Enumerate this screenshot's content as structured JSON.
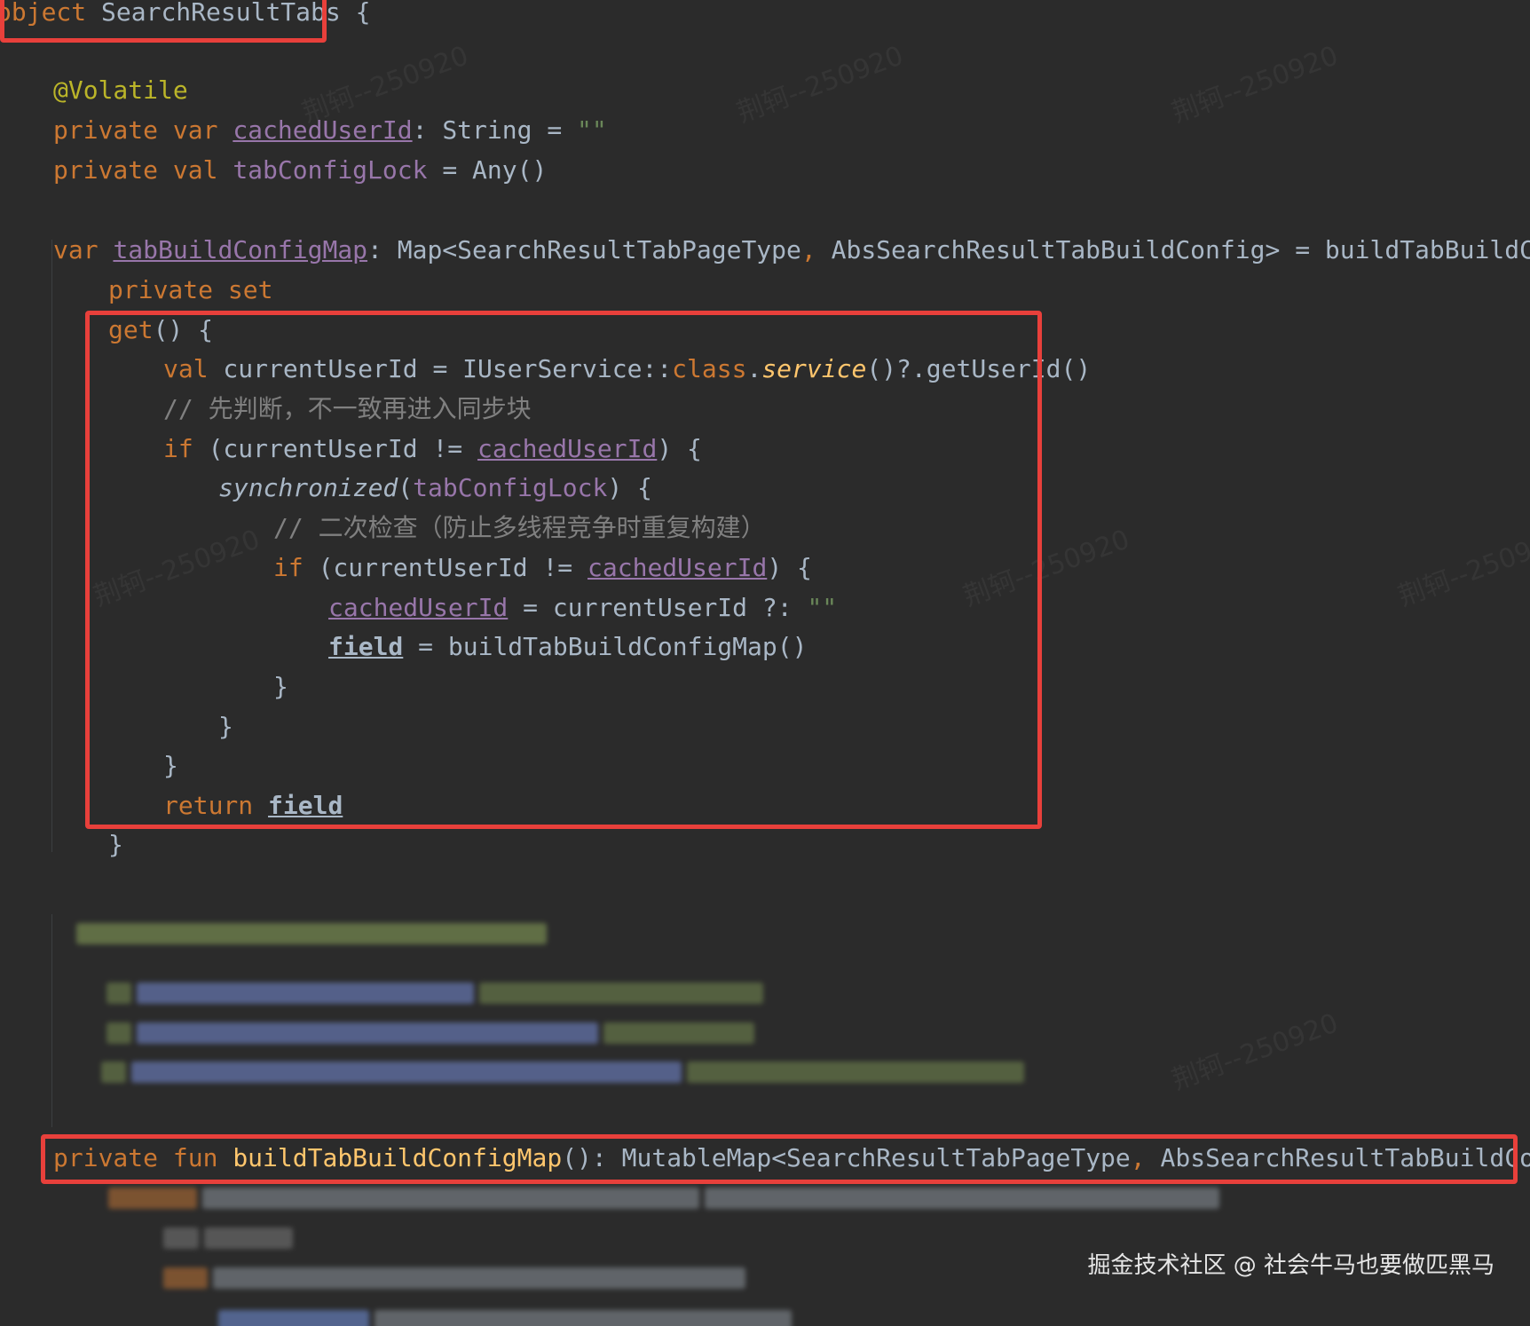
{
  "code": {
    "line_object": {
      "kw": "object",
      "name": "SearchResultTabs",
      "brace": " {"
    },
    "line_annotation": "@Volatile",
    "line_cached": {
      "kw1": "private",
      "kw2": "var",
      "prop": "cachedUserId",
      "rest": ": String = ",
      "str": "\"\""
    },
    "line_lock": {
      "kw1": "private",
      "kw2": "val",
      "prop": "tabConfigLock",
      "rest": " = Any()"
    },
    "line_map": {
      "kw": "var",
      "prop": "tabBuildConfigMap",
      "rest1": ": Map<SearchResultTabPageType",
      "comma": ",",
      "rest2": " AbsSearchResultTabBuildConfig> = buildTabBuildConfigMap("
    },
    "line_private_set": "private set",
    "line_get": {
      "kw": "get",
      "rest": "() {"
    },
    "line_val_current": {
      "kw": "val",
      "rest1": " currentUserId = IUserService::",
      "kw2": "class",
      "dot": ".",
      "fn": "service",
      "rest2": "()?.getUserId()"
    },
    "line_comment1": "// 先判断，不一致再进入同步块",
    "line_if1": {
      "kw": "if",
      "rest1": " (currentUserId != ",
      "prop": "cachedUserId",
      "rest2": ") {"
    },
    "line_sync": {
      "fn": "synchronized",
      "open": "(",
      "prop": "tabConfigLock",
      "close": ") {"
    },
    "line_comment2": "// 二次检查（防止多线程竞争时重复构建）",
    "line_if2": {
      "kw": "if",
      "rest1": " (currentUserId != ",
      "prop": "cachedUserId",
      "rest2": ") {"
    },
    "line_assign_cached": {
      "prop": "cachedUserId",
      "rest": " = currentUserId ?: ",
      "str": "\"\""
    },
    "line_assign_field": {
      "field": "field",
      "rest": " = buildTabBuildConfigMap()"
    },
    "line_close_if2": "}",
    "line_close_sync": "}",
    "line_close_if1": "}",
    "line_return": {
      "kw": "return",
      "field": "field"
    },
    "line_close_get": "}",
    "line_fun": {
      "kw1": "private",
      "kw2": "fun",
      "fn": "buildTabBuildConfigMap",
      "rest1": "(): MutableMap<SearchResultTabPageType",
      "comma": ",",
      "rest2": " AbsSearchResultTabBuildConfig> {"
    }
  },
  "watermark_text": "荆轲--250920",
  "credit": "掘金技术社区 @ 社会牛马也要做匹黑马"
}
